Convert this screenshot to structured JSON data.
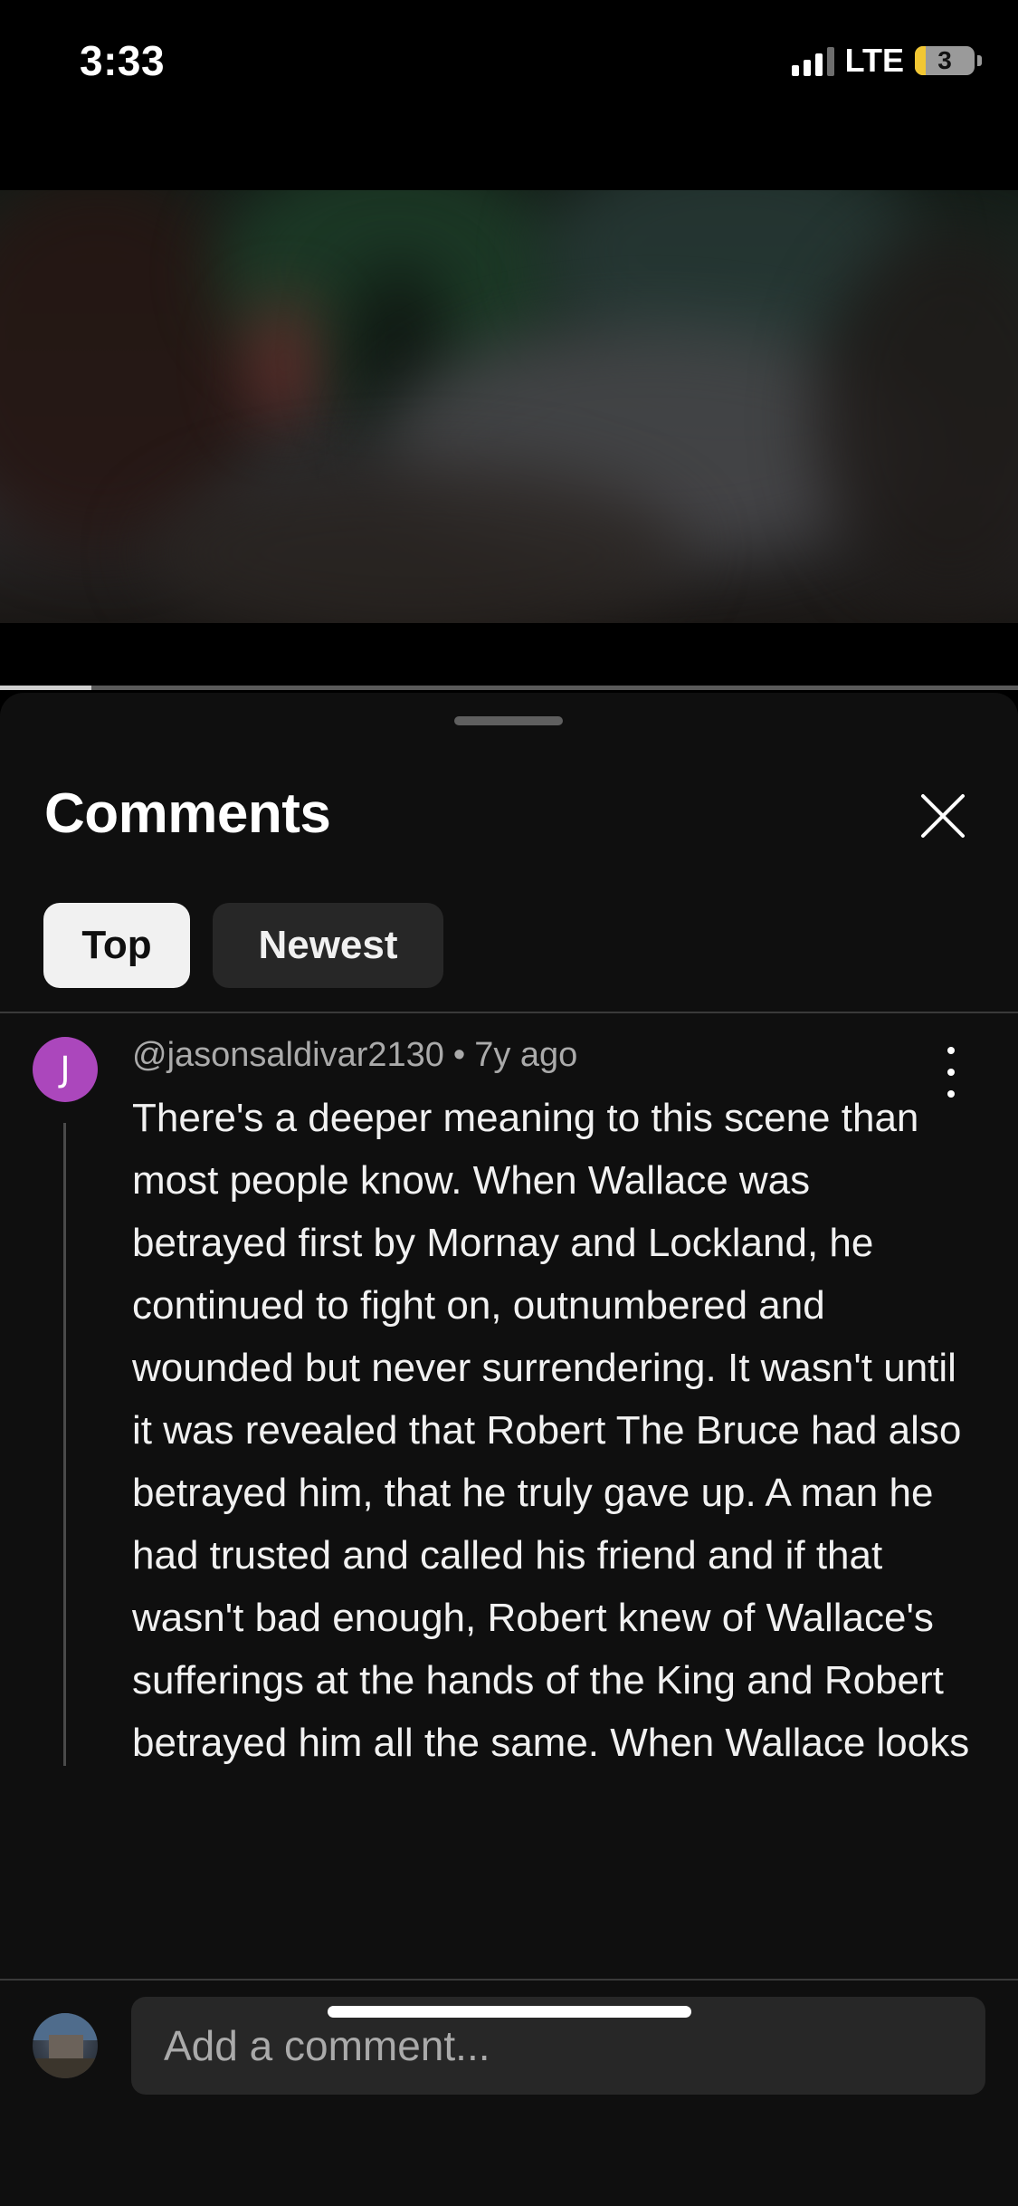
{
  "status_bar": {
    "time": "3:33",
    "network": "LTE",
    "battery": "3",
    "battery_level": 0.03,
    "signal_bars": 3
  },
  "video": {
    "progress": 0.09
  },
  "sheet": {
    "title": "Comments",
    "close_icon": "close-icon",
    "tabs": [
      {
        "label": "Top",
        "selected": true
      },
      {
        "label": "Newest",
        "selected": false
      }
    ]
  },
  "comment": {
    "avatar_letter": "J",
    "avatar_color": "#ab47bc",
    "author": "@jasonsaldivar2130",
    "time_ago": "7y ago",
    "separator": "•",
    "text": "There's a deeper meaning to this scene than most people know. When Wallace was betrayed first by Mornay and Lockland, he continued to fight on, outnumbered and wounded but never surrendering. It wasn't until it was revealed that Robert The Bruce had also betrayed him, that he truly gave up. A man he had trusted and called his friend and if that wasn't bad enough, Robert knew of Wallace's sufferings at the hands of the King and Robert betrayed him all the same. When Wallace looks over his shoulder to see"
  },
  "composer": {
    "placeholder": "Add a comment..."
  },
  "colors": {
    "background": "#000000",
    "sheet": "#0f0f0f",
    "chip_selected": "#f1f1f1",
    "chip_unselected": "#272727",
    "muted_text": "#aaaaaa"
  }
}
